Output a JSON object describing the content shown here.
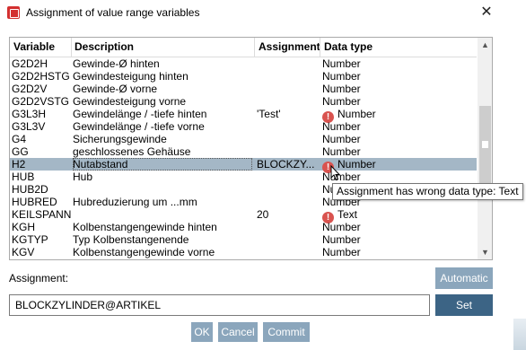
{
  "window": {
    "title": "Assignment of value range variables",
    "close_glyph": "✕"
  },
  "table": {
    "headers": {
      "variable": "Variable",
      "description": "Description",
      "assignment": "Assignment",
      "data_type": "Data type"
    },
    "rows": [
      {
        "variable": "G2D2H",
        "description": "Gewinde-Ø hinten",
        "assignment": "",
        "data_type": "Number",
        "warning": false
      },
      {
        "variable": "G2D2HSTG",
        "description": "Gewindesteigung hinten",
        "assignment": "",
        "data_type": "Number",
        "warning": false
      },
      {
        "variable": "G2D2V",
        "description": "Gewinde-Ø vorne",
        "assignment": "",
        "data_type": "Number",
        "warning": false
      },
      {
        "variable": "G2D2VSTG",
        "description": "Gewindesteigung vorne",
        "assignment": "",
        "data_type": "Number",
        "warning": false
      },
      {
        "variable": "G3L3H",
        "description": "Gewindelänge / -tiefe hinten",
        "assignment": "'Test'",
        "data_type": "Number",
        "warning": true
      },
      {
        "variable": "G3L3V",
        "description": "Gewindelänge / -tiefe vorne",
        "assignment": "",
        "data_type": "Number",
        "warning": false
      },
      {
        "variable": "G4",
        "description": "Sicherungsgewinde",
        "assignment": "",
        "data_type": "Number",
        "warning": false
      },
      {
        "variable": "GG",
        "description": "geschlossenes Gehäuse",
        "assignment": "",
        "data_type": "Number",
        "warning": false
      },
      {
        "variable": "H2",
        "description": "Nutabstand",
        "assignment": "BLOCKZY...",
        "data_type": "Number",
        "warning": true,
        "selected": true
      },
      {
        "variable": "HUB",
        "description": "Hub",
        "assignment": "",
        "data_type": "Number",
        "warning": false
      },
      {
        "variable": "HUB2D",
        "description": "",
        "assignment": "",
        "data_type": "Number",
        "warning": false
      },
      {
        "variable": "HUBRED",
        "description": "Hubreduzierung um ...mm",
        "assignment": "",
        "data_type": "Number",
        "warning": false
      },
      {
        "variable": "KEILSPANN",
        "description": "",
        "assignment": "20",
        "data_type": "Text",
        "warning": true
      },
      {
        "variable": "KGH",
        "description": "Kolbenstangengewinde hinten",
        "assignment": "",
        "data_type": "Number",
        "warning": false
      },
      {
        "variable": "KGTYP",
        "description": "Typ Kolbenstangenende",
        "assignment": "",
        "data_type": "Number",
        "warning": false
      },
      {
        "variable": "KGV",
        "description": "Kolbenstangengewinde vorne",
        "assignment": "",
        "data_type": "Number",
        "warning": false
      }
    ],
    "warning_glyph": "!"
  },
  "tooltip": {
    "text": "Assignment has wrong data type: Text"
  },
  "form": {
    "assignment_label": "Assignment:",
    "automatic_label": "Automatic",
    "assignment_value": "BLOCKZYLINDER@ARTIKEL",
    "set_label": "Set"
  },
  "buttons": {
    "ok": "OK",
    "cancel": "Cancel",
    "commit": "Commit"
  },
  "colors": {
    "selected_row": "#a4b7c6",
    "warning": "#d9534f",
    "primary_button": "#3c6485",
    "secondary_button": "#8ba6bc"
  }
}
